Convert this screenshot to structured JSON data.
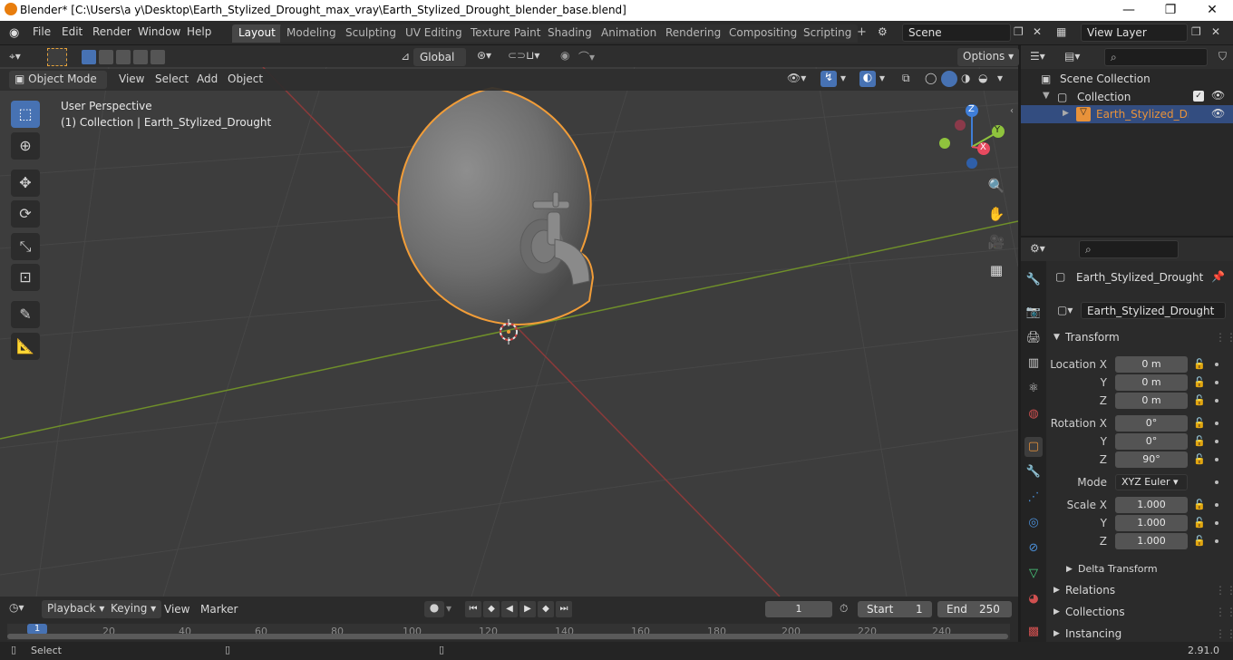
{
  "window": {
    "title": "Blender* [C:\\Users\\a y\\Desktop\\Earth_Stylized_Drought_max_vray\\Earth_Stylized_Drought_blender_base.blend]",
    "minimize": "—",
    "maximize": "❐",
    "close": "✕"
  },
  "menus": [
    "File",
    "Edit",
    "Render",
    "Window",
    "Help"
  ],
  "workspaces": [
    "Layout",
    "Modeling",
    "Sculpting",
    "UV Editing",
    "Texture Paint",
    "Shading",
    "Animation",
    "Rendering",
    "Compositing",
    "Scripting"
  ],
  "scene": {
    "name": "Scene",
    "view_layer": "View Layer"
  },
  "toolheader": {
    "orientation": "Global",
    "options": "Options"
  },
  "viewport_header": {
    "mode": "Object Mode",
    "menus": [
      "View",
      "Select",
      "Add",
      "Object"
    ]
  },
  "viewport": {
    "perspective": "User Perspective",
    "collection_info": "(1) Collection | Earth_Stylized_Drought",
    "gizmo_labels": {
      "x": "X",
      "y": "Y",
      "z": "Z"
    }
  },
  "outliner": {
    "root": "Scene Collection",
    "collection": "Collection",
    "object": "Earth_Stylized_Drought"
  },
  "properties": {
    "header_name": "Earth_Stylized_Drought",
    "data_name": "Earth_Stylized_Drought",
    "transform_title": "Transform",
    "location": {
      "label": "Location X",
      "x": "0 m",
      "y": "0 m",
      "z": "0 m"
    },
    "rotation": {
      "label": "Rotation X",
      "x": "0°",
      "y": "0°",
      "z": "90°"
    },
    "mode_label": "Mode",
    "mode_value": "XYZ Euler",
    "scale": {
      "label": "Scale X",
      "x": "1.000",
      "y": "1.000",
      "z": "1.000"
    },
    "axis_y": "Y",
    "axis_z": "Z",
    "delta_transform": "Delta Transform",
    "relations": "Relations",
    "collections": "Collections",
    "instancing": "Instancing"
  },
  "timeline": {
    "menus": [
      "Playback",
      "Keying",
      "View",
      "Marker"
    ],
    "current_frame": "1",
    "start_label": "Start",
    "start_value": "1",
    "end_label": "End",
    "end_value": "250",
    "ticks": [
      "20",
      "40",
      "60",
      "80",
      "100",
      "120",
      "140",
      "160",
      "180",
      "200",
      "220",
      "240"
    ],
    "cursor_frame": "1"
  },
  "status": {
    "select": "Select",
    "version": "2.91.0"
  },
  "colors": {
    "accent": "#4772b3",
    "selection_outline": "#f29d38",
    "x_axis": "#8b3a3a",
    "y_axis": "#6f8f2a",
    "gizmo_x": "#e84a5f",
    "gizmo_y": "#8fc33d",
    "gizmo_z": "#3f7ed8"
  }
}
